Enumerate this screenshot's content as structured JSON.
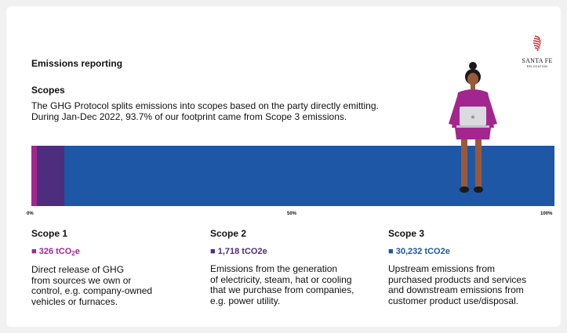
{
  "report": {
    "title": "Emissions reporting",
    "section": "Scopes",
    "intro_lines": [
      "The GHG Protocol splits emissions into scopes based on the party directly emitting.",
      "During Jan-Dec 2022, 93.7% of our footprint came from Scope 3 emissions."
    ]
  },
  "logo": {
    "name": "SANTA FE",
    "sub": "RELOCATION"
  },
  "colors": {
    "scope1": "#a3268f",
    "scope2": "#4e2c7e",
    "scope3": "#1d57a6"
  },
  "chart_data": {
    "type": "bar",
    "orientation": "horizontal-stacked",
    "series": [
      {
        "name": "Scope 1",
        "values": [
          326
        ]
      },
      {
        "name": "Scope 2",
        "values": [
          1718
        ]
      },
      {
        "name": "Scope 3",
        "values": [
          30232
        ]
      }
    ],
    "x_ticks": [
      "0%",
      "50%",
      "100%"
    ],
    "xlim": [
      0,
      100
    ]
  },
  "scopes": [
    {
      "title": "Scope 1",
      "value_num": "326 tCO",
      "value_sub": "2",
      "value_suffix": "e",
      "desc_lines": [
        "Direct release of GHG",
        "from sources we own or",
        "control, e.g. company-owned",
        "vehicles or furnaces."
      ]
    },
    {
      "title": "Scope 2",
      "value_num": "1,718 tCO2e",
      "value_sub": "",
      "value_suffix": "",
      "desc_lines": [
        "Emissions from the generation",
        "of electricity, steam, hat or cooling",
        "that we purchase from companies,",
        "e.g. power utility."
      ]
    },
    {
      "title": "Scope 3",
      "value_num": "30,232 tCO2e",
      "value_sub": "",
      "value_suffix": "",
      "desc_lines": [
        "Upstream emissions from",
        "purchased products and services",
        "and downstream emissions from",
        "customer product use/disposal."
      ]
    }
  ],
  "marker": "■"
}
